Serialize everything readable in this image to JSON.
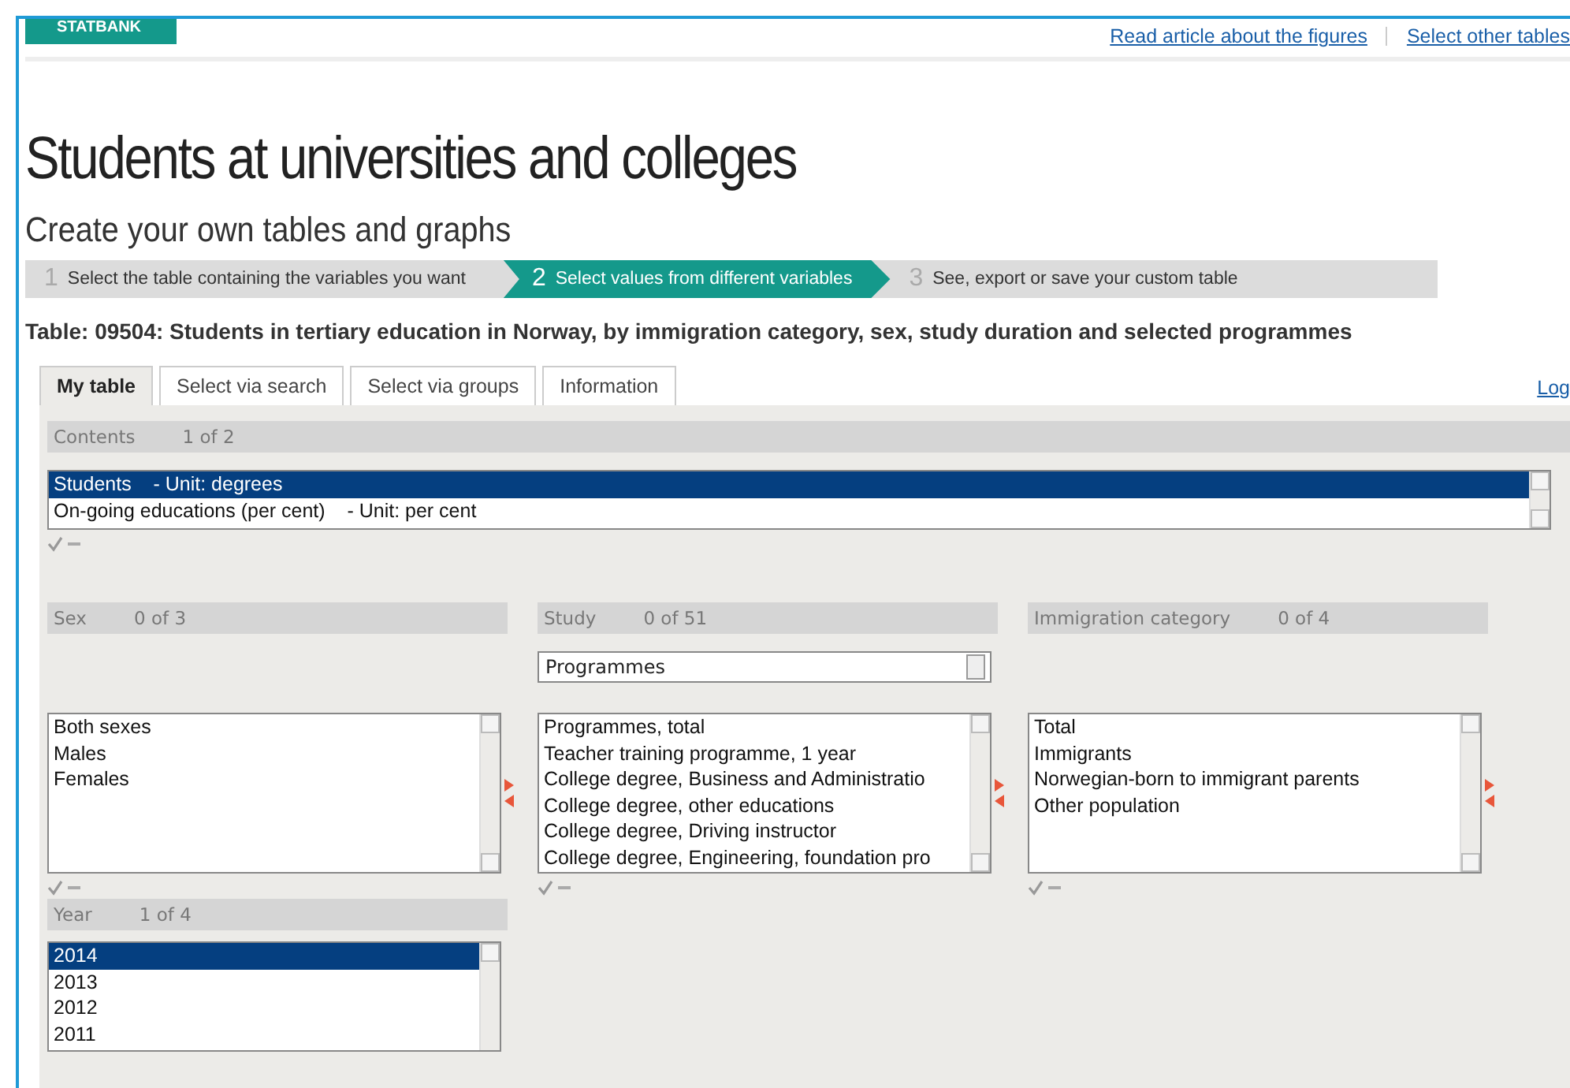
{
  "header": {
    "logo": "STATBANK",
    "links": [
      "Read article about the figures",
      "Select other tables"
    ]
  },
  "title": "Students at universities and colleges",
  "subtitle": "Create your own tables and graphs",
  "steps": [
    {
      "number": "1",
      "label": "Select the table containing the variables you want",
      "selected": false
    },
    {
      "number": "2",
      "label": "Select values from different variables",
      "selected": true
    },
    {
      "number": "3",
      "label": "See, export or save your custom table",
      "selected": false
    }
  ],
  "table_title": "Table: 09504: Students in tertiary education in Norway, by immigration category, sex, study duration and selected programmes",
  "tabs": [
    {
      "label": "My table",
      "selected": true
    },
    {
      "label": "Select via search",
      "selected": false
    },
    {
      "label": "Select via groups",
      "selected": false
    },
    {
      "label": "Information",
      "selected": false
    }
  ],
  "log_link": "Log",
  "contents": {
    "label": "Contents",
    "count": "1 of 2",
    "items": [
      {
        "text": "Students    - Unit: degrees",
        "selected": true
      },
      {
        "text": "On-going educations (per cent)    - Unit: per cent",
        "selected": false
      }
    ]
  },
  "variables": [
    {
      "label": "Sex",
      "count": "0 of 3",
      "items": [
        {
          "text": "Both sexes",
          "selected": false
        },
        {
          "text": "Males",
          "selected": false
        },
        {
          "text": "Females",
          "selected": false
        }
      ]
    },
    {
      "label": "Study",
      "count": "0 of 51",
      "dropdown": "Programmes",
      "items": [
        {
          "text": "Programmes, total",
          "selected": false
        },
        {
          "text": "Teacher training programme, 1 year",
          "selected": false
        },
        {
          "text": "College degree, Business and Administratio",
          "selected": false
        },
        {
          "text": "College degree, other educations",
          "selected": false
        },
        {
          "text": "College degree, Driving instructor",
          "selected": false
        },
        {
          "text": "College degree, Engineering, foundation pro",
          "selected": false
        }
      ]
    },
    {
      "label": "Immigration category",
      "count": "0 of 4",
      "items": [
        {
          "text": "Total",
          "selected": false
        },
        {
          "text": "Immigrants",
          "selected": false
        },
        {
          "text": "Norwegian-born to immigrant parents",
          "selected": false
        },
        {
          "text": "Other population",
          "selected": false
        }
      ]
    }
  ],
  "year": {
    "label": "Year",
    "count": "1 of 4",
    "items": [
      {
        "text": "2014",
        "selected": true
      },
      {
        "text": "2013",
        "selected": false
      },
      {
        "text": "2012",
        "selected": false
      },
      {
        "text": "2011",
        "selected": false
      }
    ]
  }
}
